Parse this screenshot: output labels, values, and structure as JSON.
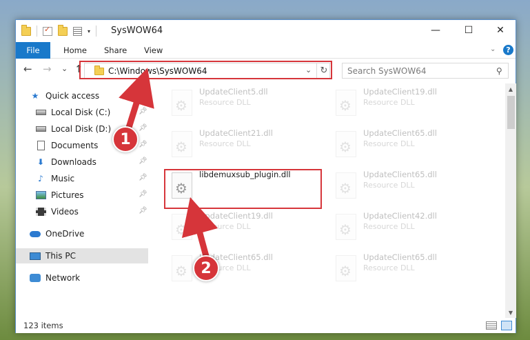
{
  "window": {
    "title": "SysWOW64"
  },
  "window_controls": {
    "minimize": "—",
    "maximize": "☐",
    "close": "✕"
  },
  "ribbon": {
    "tabs": [
      "File",
      "Home",
      "Share",
      "View"
    ],
    "help": "?"
  },
  "navigation": {
    "back": "←",
    "forward": "→",
    "recent": "⌄",
    "up": "↑",
    "address": "C:\\Windows\\SysWOW64",
    "refresh": "↻",
    "search_placeholder": "Search SysWOW64"
  },
  "sidebar": {
    "items": [
      {
        "label": "Quick access",
        "icon": "star-icon"
      },
      {
        "label": "Local Disk (C:)",
        "icon": "drive-icon",
        "pinned": true
      },
      {
        "label": "Local Disk (D:)",
        "icon": "drive-icon",
        "pinned": true
      },
      {
        "label": "Documents",
        "icon": "documents-icon",
        "pinned": true
      },
      {
        "label": "Downloads",
        "icon": "download-icon",
        "pinned": true
      },
      {
        "label": "Music",
        "icon": "music-icon",
        "pinned": true
      },
      {
        "label": "Pictures",
        "icon": "pictures-icon",
        "pinned": true
      },
      {
        "label": "Videos",
        "icon": "videos-icon",
        "pinned": true
      },
      {
        "label": "OneDrive",
        "icon": "cloud-icon"
      },
      {
        "label": "This PC",
        "icon": "computer-icon",
        "selected": true
      },
      {
        "label": "Network",
        "icon": "network-icon"
      }
    ]
  },
  "files": [
    {
      "name": "UpdateClient5.dll",
      "type": "Resource DLL"
    },
    {
      "name": "UpdateClient19.dll",
      "type": "Resource DLL"
    },
    {
      "name": "UpdateClient21.dll",
      "type": "Resource DLL"
    },
    {
      "name": "UpdateClient65.dll",
      "type": "Resource DLL"
    },
    {
      "name": "libdemuxsub_plugin.dll",
      "type": ""
    },
    {
      "name": "UpdateClient65.dll",
      "type": "Resource DLL"
    },
    {
      "name": "UpdateClient19.dll",
      "type": "Resource DLL"
    },
    {
      "name": "UpdateClient42.dll",
      "type": "Resource DLL"
    },
    {
      "name": "UpdateClient65.dll",
      "type": "Resource DLL"
    },
    {
      "name": "UpdateClient65.dll",
      "type": "Resource DLL"
    }
  ],
  "status": {
    "item_count": "123 items"
  },
  "annotations": {
    "step1": "1",
    "step2": "2",
    "color": "#d6353a"
  }
}
